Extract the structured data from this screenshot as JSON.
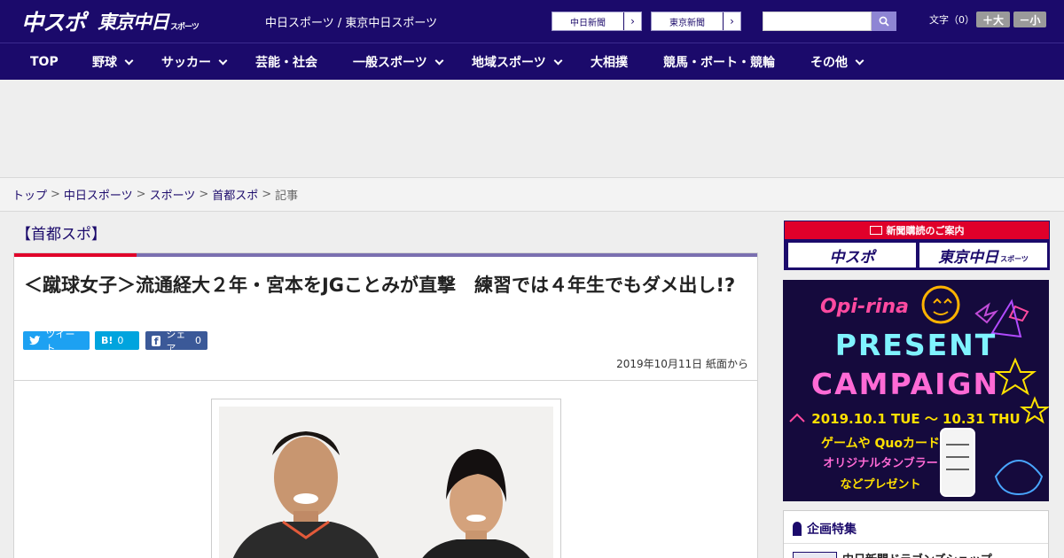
{
  "header": {
    "logo_chuspo": "中スポ",
    "logo_tokyo": "東京中日",
    "logo_tokyo_suffix": "スポーツ",
    "site_names": "中日スポーツ / 東京中日スポーツ",
    "link_chunichi": "中日新聞",
    "link_tokyo": "東京新聞",
    "search_placeholder": "",
    "font_size_label": "文字（0）",
    "font_plus": "＋大",
    "font_minus": "－小"
  },
  "nav": {
    "items": [
      {
        "label": "TOP"
      },
      {
        "label": "野球"
      },
      {
        "label": "サッカー"
      },
      {
        "label": "芸能・社会"
      },
      {
        "label": "一般スポーツ"
      },
      {
        "label": "地域スポーツ"
      },
      {
        "label": "大相撲"
      },
      {
        "label": "競馬・ボート・競輪"
      },
      {
        "label": "その他"
      }
    ]
  },
  "breadcrumb": {
    "items": [
      "トップ",
      "中日スポーツ",
      "スポーツ",
      "首都スポ",
      "記事"
    ],
    "separator": ">"
  },
  "article": {
    "section": "【首都スポ】",
    "headline": "＜蹴球女子＞流通経大２年・宮本をJGことみが直撃　練習では４年生でもダメ出し!?",
    "share": {
      "tweet_label": "ツイート",
      "hatena_label": "B!",
      "hatena_count": "0",
      "facebook_label": "シェア",
      "facebook_count": "0"
    },
    "date": "2019年10月11日 紙面から"
  },
  "sidebar": {
    "subscribe_head": "新聞購読のご案内",
    "subscribe_chuspo": "中スポ",
    "subscribe_tokyo": "東京中日",
    "subscribe_tokyo_suffix": "スポーツ",
    "promo": {
      "brand": "Opi-rina",
      "line1": "PRESENT",
      "line2": "CAMPAIGN",
      "period": "2019.10.1 TUE 〜 10.31 THU",
      "desc1": "ゲームや Quoカード",
      "desc2": "オリジナルタンブラー",
      "desc3": "などプレゼント"
    },
    "feature_title": "企画特集",
    "feature_item": "中日新聞ドラゴンズショップ"
  },
  "colors": {
    "brand_navy": "#1b0a6b",
    "accent_red": "#e0002a",
    "twitter": "#1da1f2",
    "hatena": "#00a4de",
    "facebook": "#3b5998"
  }
}
